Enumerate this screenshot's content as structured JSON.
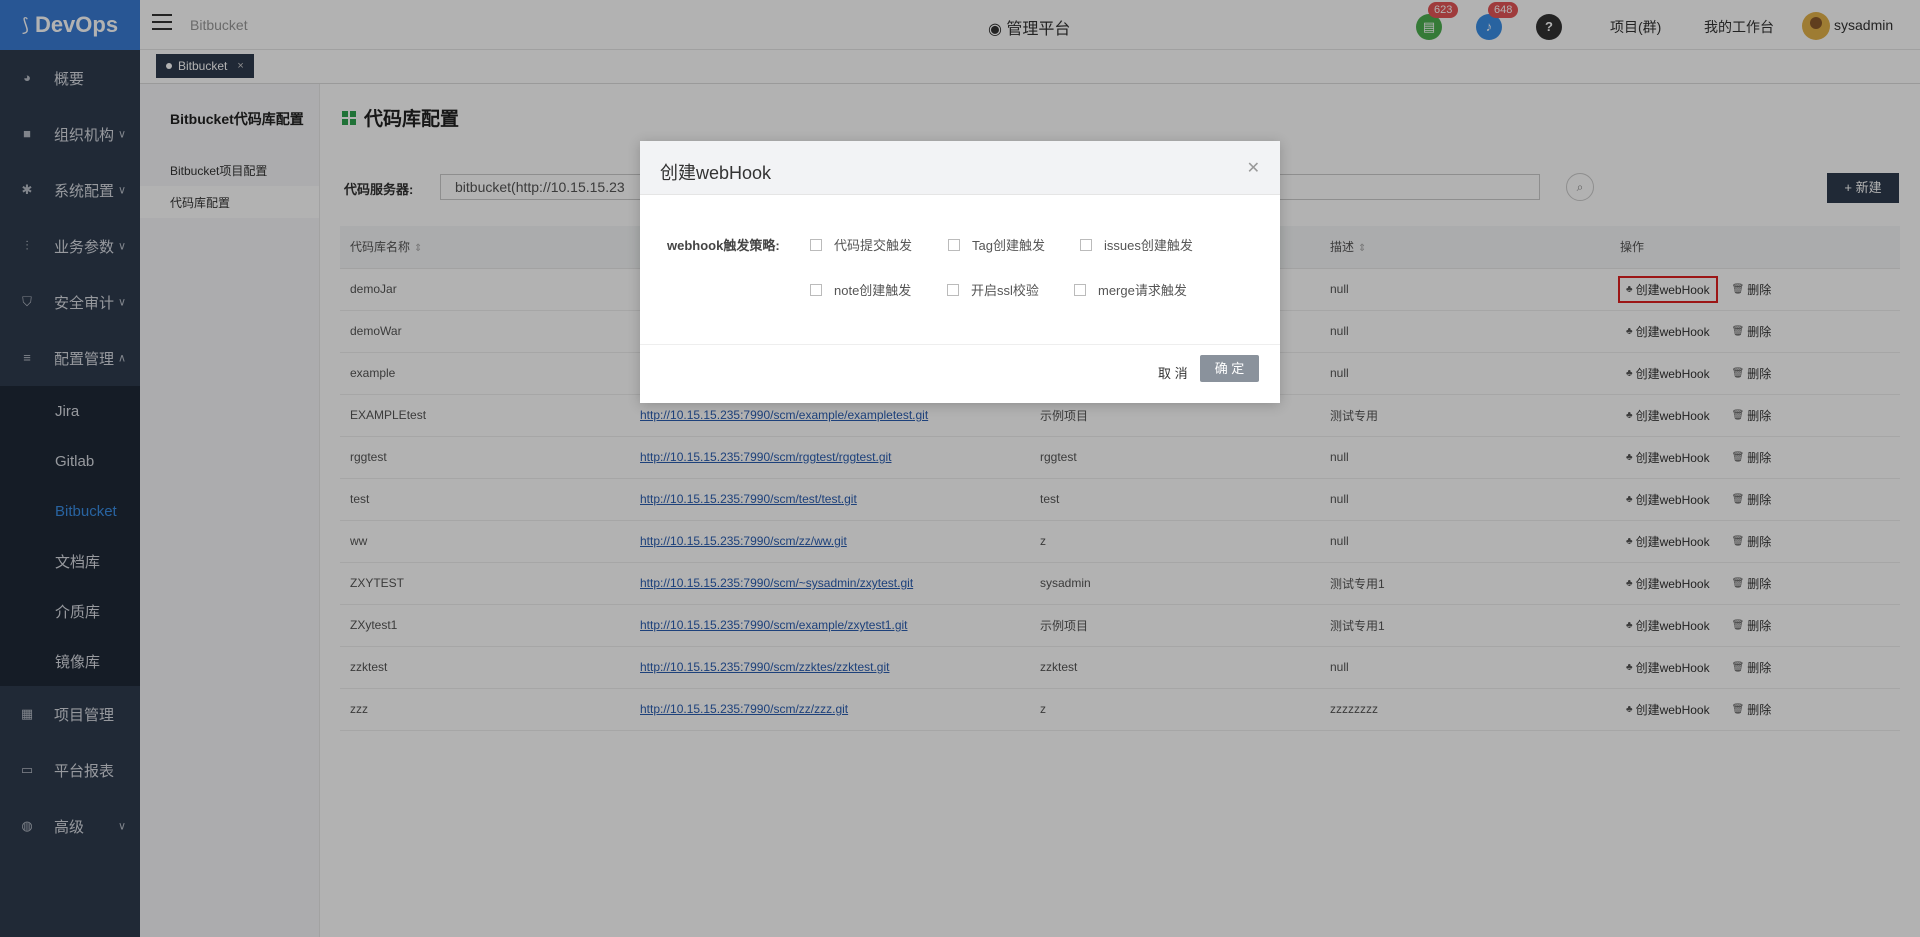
{
  "app": {
    "logo": "DevOps"
  },
  "sidebar": {
    "items": [
      {
        "label": "概要",
        "icon": "dashboard-icon"
      },
      {
        "label": "组织机构",
        "icon": "lock-icon"
      },
      {
        "label": "系统配置",
        "icon": "gear-icon"
      },
      {
        "label": "业务参数",
        "icon": "sliders-icon"
      },
      {
        "label": "安全审计",
        "icon": "shield-icon"
      },
      {
        "label": "配置管理",
        "icon": "database-icon"
      }
    ],
    "subitems": [
      "Jira",
      "Gitlab",
      "Bitbucket",
      "文档库",
      "介质库",
      "镜像库"
    ],
    "bottom_items": [
      {
        "label": "项目管理",
        "icon": "grid-icon"
      },
      {
        "label": "平台报表",
        "icon": "monitor-icon"
      },
      {
        "label": "高级",
        "icon": "palette-icon"
      }
    ]
  },
  "topbar": {
    "crumb": "Bitbucket",
    "platform": "管理平台",
    "badge1": "623",
    "badge2": "648",
    "help": "?",
    "link_projects": "项目(群)",
    "link_workbench": "我的工作台",
    "user": "sysadmin"
  },
  "tabs": {
    "active": "Bitbucket"
  },
  "leftnav": {
    "title": "Bitbucket代码库配置",
    "items": [
      "Bitbucket项目配置",
      "代码库配置"
    ]
  },
  "main": {
    "title": "代码库配置",
    "server_label": "代码服务器:",
    "server_value": "bitbucket(http://10.15.15.23",
    "new_button": "+ 新建"
  },
  "table": {
    "headers": [
      "代码库名称",
      "",
      "",
      "描述",
      "操作"
    ],
    "rows": [
      {
        "name": "demoJar",
        "url": "",
        "project": "",
        "desc": "null"
      },
      {
        "name": "demoWar",
        "url": "",
        "project": "",
        "desc": "null"
      },
      {
        "name": "example",
        "url": "",
        "project": "",
        "desc": "null"
      },
      {
        "name": "EXAMPLEtest",
        "url": "http://10.15.15.235:7990/scm/example/exampletest.git",
        "project": "示例项目",
        "desc": "测试专用"
      },
      {
        "name": "rggtest",
        "url": "http://10.15.15.235:7990/scm/rggtest/rggtest.git",
        "project": "rggtest",
        "desc": "null"
      },
      {
        "name": "test",
        "url": "http://10.15.15.235:7990/scm/test/test.git",
        "project": "test",
        "desc": "null"
      },
      {
        "name": "ww",
        "url": "http://10.15.15.235:7990/scm/zz/ww.git",
        "project": "z",
        "desc": "null"
      },
      {
        "name": "ZXYTEST",
        "url": "http://10.15.15.235:7990/scm/~sysadmin/zxytest.git",
        "project": "sysadmin",
        "desc": "测试专用1"
      },
      {
        "name": "ZXytest1",
        "url": "http://10.15.15.235:7990/scm/example/zxytest1.git",
        "project": "示例项目",
        "desc": "测试专用1"
      },
      {
        "name": "zzktest",
        "url": "http://10.15.15.235:7990/scm/zzktes/zzktest.git",
        "project": "zzktest",
        "desc": "null"
      },
      {
        "name": "zzz",
        "url": "http://10.15.15.235:7990/scm/zz/zzz.git",
        "project": "z",
        "desc": "zzzzzzzz"
      }
    ],
    "op_create": "创建webHook",
    "op_delete": "删除"
  },
  "modal": {
    "title": "创建webHook",
    "strategy_label": "webhook触发策略:",
    "options": [
      "代码提交触发",
      "Tag创建触发",
      "issues创建触发",
      "note创建触发",
      "开启ssl校验",
      "merge请求触发"
    ],
    "cancel": "取 消",
    "ok": "确 定"
  },
  "colors": {
    "accent": "#3a7bd5",
    "sidebar": "#2e3b4e",
    "highlight": "#e02020"
  }
}
